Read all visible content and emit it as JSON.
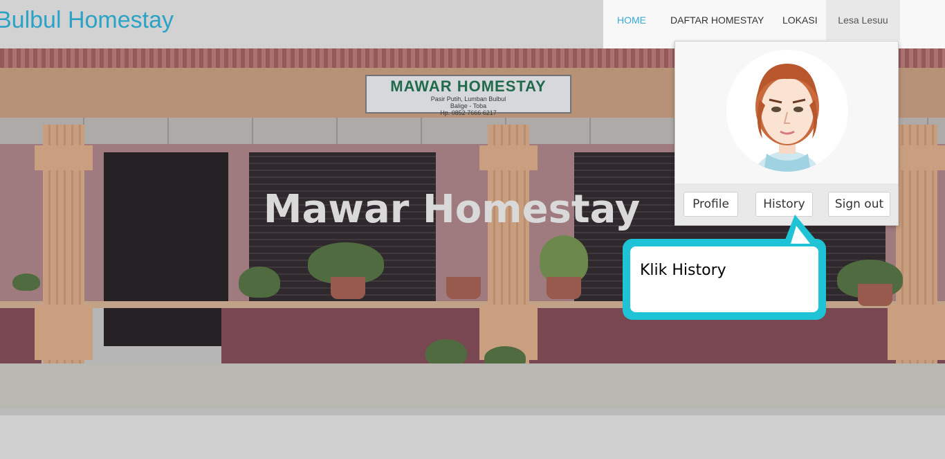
{
  "header": {
    "brand": "Bulbul Homestay",
    "nav": {
      "home": "HOME",
      "daftar_homestay": "DAFTAR HOMESTAY",
      "lokasi": "LOKASI",
      "user": "Lesa Lesuu"
    }
  },
  "hero": {
    "title": "Mawar Homestay",
    "sign": {
      "title": "MAWAR HOMESTAY",
      "line1": "Pasir Putih, Lumban Bulbul",
      "line2": "Balige - Toba",
      "phone": "Hp. 0852 7666 6217"
    }
  },
  "dropdown": {
    "profile_label": "Profile",
    "history_label": "History",
    "signout_label": "Sign out"
  },
  "callout": {
    "text": "Klik History"
  },
  "colors": {
    "brand": "#2aa3c6",
    "nav_active": "#36a9d3",
    "callout": "#1fc3d6"
  }
}
